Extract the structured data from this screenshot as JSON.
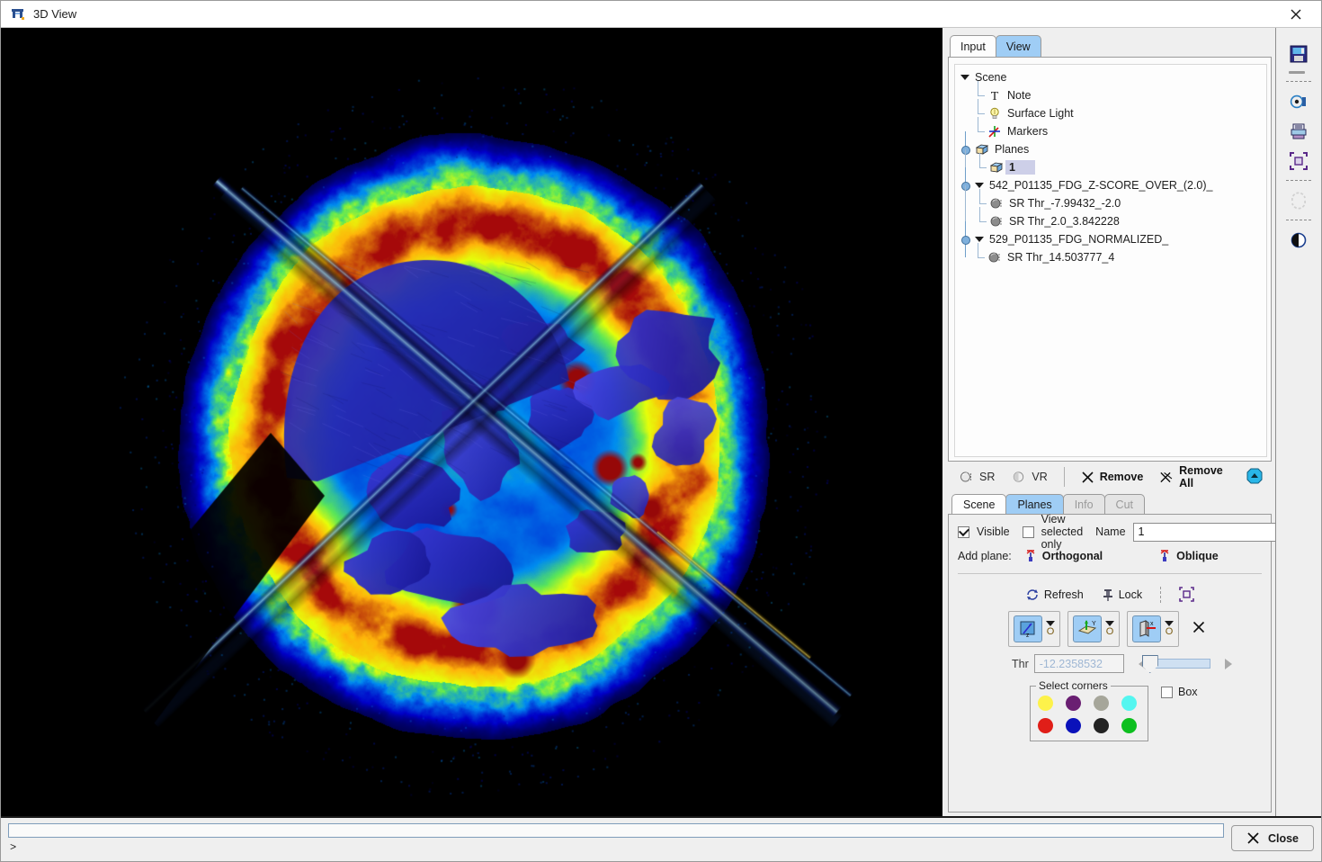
{
  "window": {
    "title": "3D View",
    "icon": "app-3dview-icon",
    "close_icon": "close-icon"
  },
  "tabs": {
    "items": [
      {
        "label": "Input",
        "active": false
      },
      {
        "label": "View",
        "active": true
      }
    ]
  },
  "tree": {
    "root_label": "Scene",
    "items": [
      {
        "label": "Note",
        "icon": "text-note-icon",
        "depth": 1,
        "selected": false
      },
      {
        "label": "Surface Light",
        "icon": "light-bulb-icon",
        "depth": 1,
        "selected": false
      },
      {
        "label": "Markers",
        "icon": "markers-axes-icon",
        "depth": 1,
        "selected": false
      },
      {
        "label": "Planes",
        "icon": "planes-cube-icon",
        "depth": 1,
        "selected": false,
        "expandable": true
      },
      {
        "label": "1",
        "icon": "plane-cube-icon",
        "depth": 2,
        "selected": true
      },
      {
        "label": "542_P01135_FDG_Z-SCORE_OVER_(2.0)_",
        "icon": "caret-down-icon",
        "depth": 1,
        "selected": false,
        "group": true
      },
      {
        "label": "SR Thr_-7.99432_-2.0",
        "icon": "surface-sphere-icon",
        "depth": 2,
        "selected": false
      },
      {
        "label": "SR Thr_2.0_3.842228",
        "icon": "surface-sphere-icon",
        "depth": 2,
        "selected": false
      },
      {
        "label": "529_P01135_FDG_NORMALIZED_",
        "icon": "caret-down-icon",
        "depth": 1,
        "selected": false,
        "group": true
      },
      {
        "label": "SR Thr_14.503777_4",
        "icon": "surface-sphere-icon",
        "depth": 2,
        "selected": false
      }
    ]
  },
  "actions": {
    "sr_label": "SR",
    "vr_label": "VR",
    "remove_label": "Remove",
    "remove_all_label": "Remove All",
    "collapse_icon": "collapse-up-icon"
  },
  "subtabs": {
    "items": [
      {
        "label": "Scene",
        "active": false,
        "enabled": true
      },
      {
        "label": "Planes",
        "active": true,
        "enabled": true
      },
      {
        "label": "Info",
        "active": false,
        "enabled": false
      },
      {
        "label": "Cut",
        "active": false,
        "enabled": false
      }
    ]
  },
  "plane_panel": {
    "visible_label": "Visible",
    "visible_checked": true,
    "view_selected_only_label": "View selected only",
    "view_selected_only_checked": false,
    "name_label": "Name",
    "name_value": "1",
    "add_plane_label": "Add plane:",
    "orthogonal_label": "Orthogonal",
    "oblique_label": "Oblique",
    "refresh_label": "Refresh",
    "lock_label": "Lock",
    "fit_icon": "fit-to-view-icon",
    "axes": [
      {
        "axis": "Z",
        "icon": "plane-z-icon",
        "active": true,
        "marker": "O"
      },
      {
        "axis": "Y",
        "icon": "plane-y-icon",
        "active": true,
        "marker": "O"
      },
      {
        "axis": "X",
        "icon": "plane-x-icon",
        "active": true,
        "marker": "O"
      }
    ],
    "delete_icon": "delete-x-icon",
    "thr_label": "Thr",
    "thr_value": "-12.2358532",
    "slider_position_percent": 4,
    "corners_legend": "Select corners",
    "corner_colors": [
      "#fdf24a",
      "#6a1f72",
      "#a6a69a",
      "#54f6f0",
      "#e01e18",
      "#0a11ba",
      "#232323",
      "#0dbf1f"
    ],
    "box_label": "Box",
    "box_checked": false
  },
  "vtoolbar": {
    "items": [
      {
        "icon": "save-floppy-icon",
        "enabled": true
      },
      {
        "icon": "snapshot-camera-icon",
        "enabled": true
      },
      {
        "icon": "print-icon",
        "enabled": true
      },
      {
        "icon": "fit-to-view-icon",
        "enabled": true
      },
      {
        "icon": "rotate-refresh-icon",
        "enabled": false
      },
      {
        "icon": "contrast-icon",
        "enabled": true
      }
    ]
  },
  "bottom": {
    "command_value": "",
    "prompt": ">",
    "close_label": "Close",
    "close_icon": "close-x-icon"
  },
  "viewport": {
    "render_description": "3D volume rendering of FDG PET brain study with oblique cut planes",
    "background_color": "#000000"
  }
}
